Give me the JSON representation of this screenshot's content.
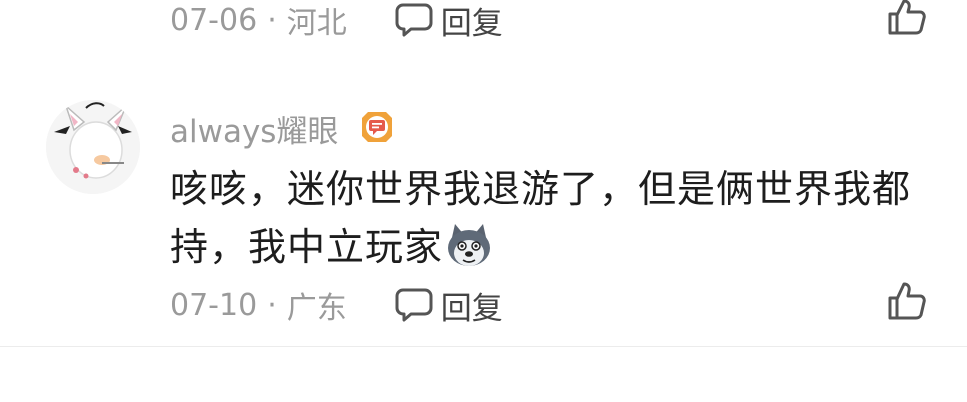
{
  "prev_comment": {
    "date": "07-06",
    "location": "河北",
    "reply_label": "回复"
  },
  "comment": {
    "username": "always耀眼",
    "text": "咳咳，迷你世界我退游了，但是俩世界我都持，我中立玩家",
    "date": "07-10",
    "location": "广东",
    "reply_label": "回复",
    "emoji_icon": "husky-dog-emoji",
    "badge_icon": "chat-badge-icon"
  },
  "colors": {
    "meta_text": "#9a9a9a",
    "comment_text": "#1d1d1d",
    "badge_orange": "#f0a23a",
    "badge_red": "#e55a4b"
  }
}
